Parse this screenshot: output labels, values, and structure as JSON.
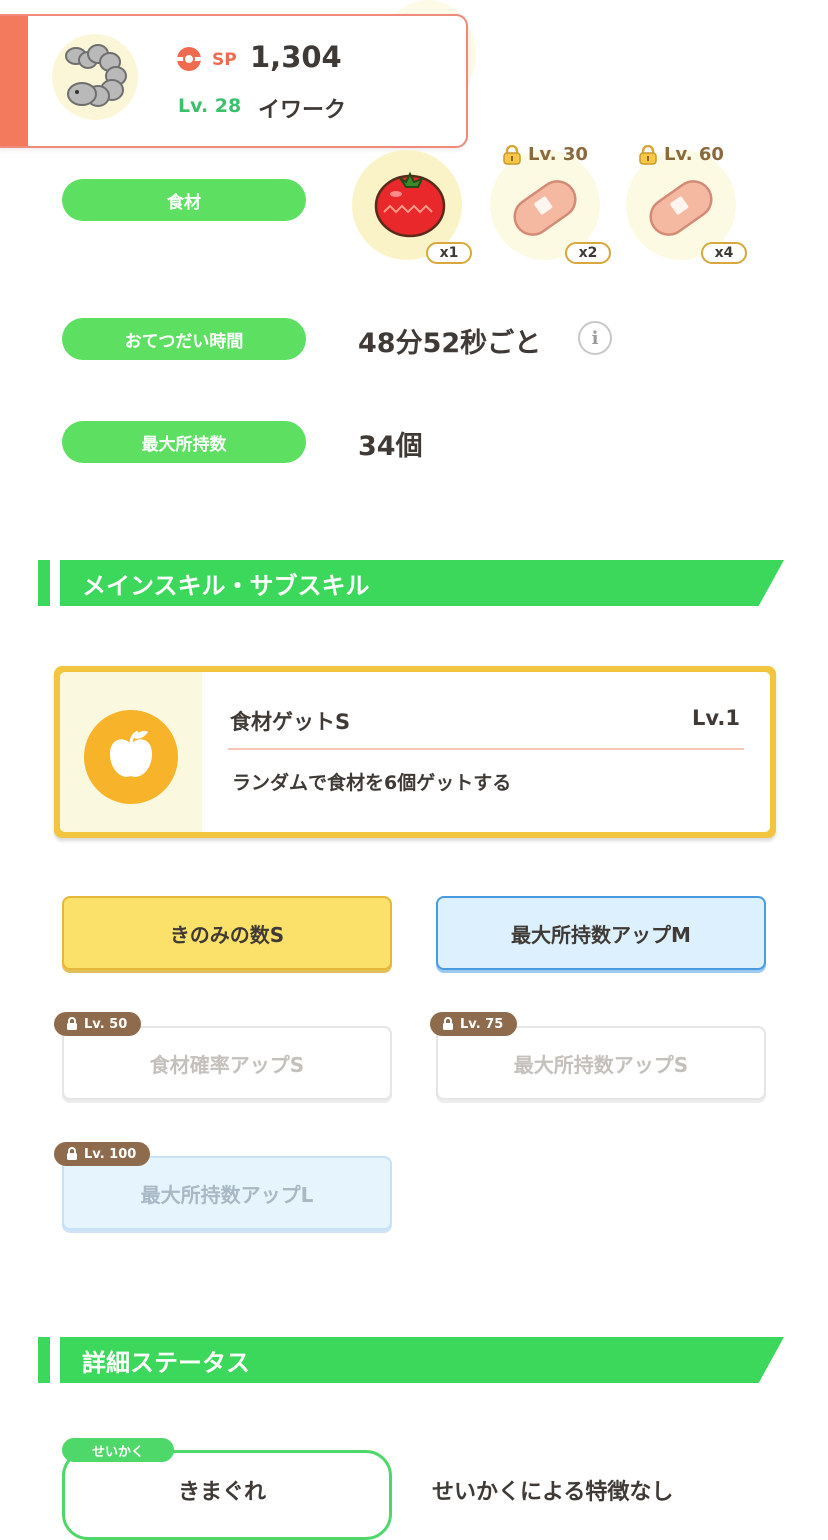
{
  "header": {
    "sp_label": "SP",
    "sp_value": "1,304",
    "level": "Lv. 28",
    "pokemon_name": "イワーク"
  },
  "ingredients": {
    "label": "食材",
    "items": [
      {
        "name": "tomato",
        "qty": "x1",
        "lock_level": ""
      },
      {
        "name": "sausage",
        "qty": "x2",
        "lock_level": "Lv. 30"
      },
      {
        "name": "sausage",
        "qty": "x4",
        "lock_level": "Lv. 60"
      }
    ]
  },
  "help_time": {
    "label": "おてつだい時間",
    "value": "48分52秒ごと"
  },
  "max_carry": {
    "label": "最大所持数",
    "value": "34個"
  },
  "skills_section": {
    "title": "メインスキル・サブスキル",
    "main_skill": {
      "name": "食材ゲットS",
      "level": "Lv.1",
      "description": "ランダムで食材を6個ゲットする"
    },
    "sub_skills": [
      {
        "label": "きのみの数S",
        "lock_level": "",
        "style": "yellow"
      },
      {
        "label": "最大所持数アップM",
        "lock_level": "",
        "style": "blue"
      },
      {
        "label": "食材確率アップS",
        "lock_level": "Lv. 50",
        "style": "locked"
      },
      {
        "label": "最大所持数アップS",
        "lock_level": "Lv. 75",
        "style": "locked"
      },
      {
        "label": "最大所持数アップL",
        "lock_level": "Lv. 100",
        "style": "locked-blue"
      }
    ]
  },
  "details_section": {
    "title": "詳細ステータス",
    "nature_label": "せいかく",
    "nature_value": "きまぐれ",
    "nature_effect": "せいかくによる特徴なし"
  },
  "colors": {
    "accent_green": "#3cd85c",
    "pill_green": "#5de062",
    "sp_red": "#ef6a4f",
    "header_accent": "#f47a5e",
    "skill_gold": "#f2c53e"
  }
}
